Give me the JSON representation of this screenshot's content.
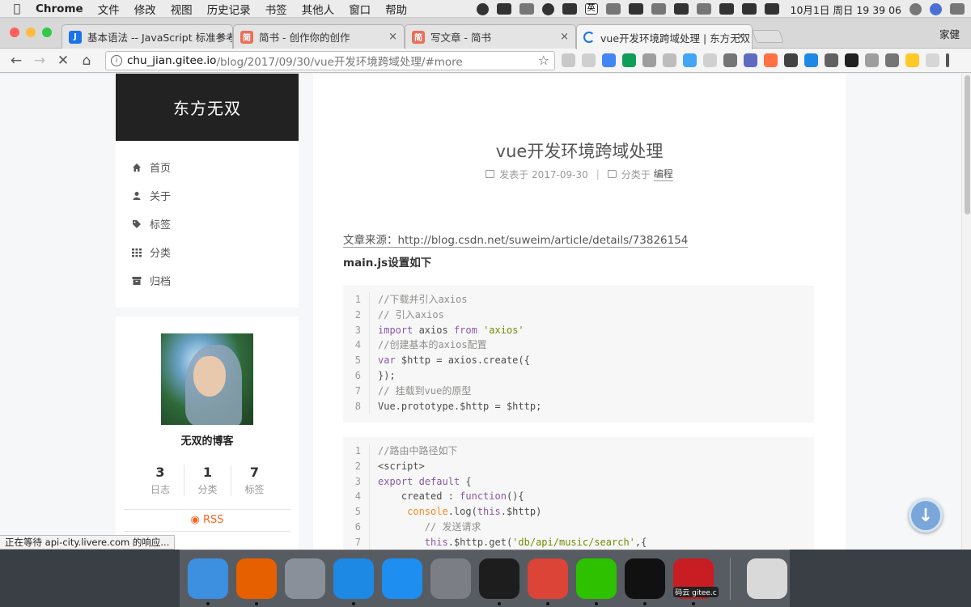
{
  "menubar": {
    "app_name": "Chrome",
    "items": [
      "文件",
      "修改",
      "视图",
      "历史记录",
      "书签",
      "其他人",
      "窗口",
      "帮助"
    ],
    "input_method": "英",
    "clock": "10月1日 周日  19 39 06"
  },
  "tabs": [
    {
      "label": "基本语法 -- JavaScript 标准参考",
      "favicon_letter": "J",
      "favicon_color": "#1a73e8"
    },
    {
      "label": "简书 - 创作你的创作",
      "favicon_letter": "简",
      "favicon_color": "#ea6f5a"
    },
    {
      "label": "写文章 - 简书",
      "favicon_letter": "简",
      "favicon_color": "#ea6f5a"
    },
    {
      "label": "vue开发环境跨域处理 | 东方无双",
      "loading": true
    }
  ],
  "profile_name": "家健",
  "address": {
    "host": "chu_jian.gitee.io",
    "path": "/blog/2017/09/30/vue开发环境跨域处理/#more"
  },
  "sidebar": {
    "brand": "东方无双",
    "menu": [
      {
        "label": "首页",
        "icon": "home-icon"
      },
      {
        "label": "关于",
        "icon": "user-icon"
      },
      {
        "label": "标签",
        "icon": "tags-icon"
      },
      {
        "label": "分类",
        "icon": "th-icon"
      },
      {
        "label": "归档",
        "icon": "archive-icon"
      }
    ],
    "author": "无双的博客",
    "stats": [
      {
        "num": "3",
        "label": "日志"
      },
      {
        "num": "1",
        "label": "分类"
      },
      {
        "num": "7",
        "label": "标签"
      }
    ],
    "rss": "RSS"
  },
  "post": {
    "title": "vue开发环境跨域处理",
    "meta_posted": "发表于 2017-09-30",
    "meta_category_prefix": "分类于",
    "meta_category": "编程",
    "source_label": "文章来源：http://blog.csdn.net/suweim/article/details/73826154",
    "subhead": "main.js设置如下"
  },
  "code_block_1": [
    [
      [
        "c-com",
        "//下载并引入axios"
      ]
    ],
    [
      [
        "c-com",
        "// 引入axios"
      ]
    ],
    [
      [
        "c-kw",
        "import"
      ],
      [
        "",
        " axios "
      ],
      [
        "c-kw",
        "from"
      ],
      [
        "",
        " "
      ],
      [
        "c-str",
        "'axios'"
      ]
    ],
    [
      [
        "c-com",
        "//创建基本的axios配置"
      ]
    ],
    [
      [
        "c-kw",
        "var"
      ],
      [
        "",
        " $http = axios.create({"
      ]
    ],
    [
      [
        "",
        "});"
      ]
    ],
    [
      [
        "c-com",
        "// 挂载到vue的原型"
      ]
    ],
    [
      [
        "",
        "Vue.prototype.$http = $http;"
      ]
    ]
  ],
  "code_block_2": [
    [
      [
        "c-com",
        "//路由中路径如下"
      ]
    ],
    [
      [
        "",
        "<script>"
      ]
    ],
    [
      [
        "c-kw",
        "export"
      ],
      [
        "",
        " "
      ],
      [
        "c-kw",
        "default"
      ],
      [
        "",
        " {"
      ]
    ],
    [
      [
        "",
        "    created : "
      ],
      [
        "c-kw",
        "function"
      ],
      [
        "",
        "(){"
      ]
    ],
    [
      [
        "",
        "     "
      ],
      [
        "c-obj",
        "console"
      ],
      [
        "",
        ".log("
      ],
      [
        "c-kw",
        "this"
      ],
      [
        "",
        ".$http)"
      ]
    ],
    [
      [
        "",
        "        "
      ],
      [
        "c-com",
        "// 发送请求"
      ]
    ],
    [
      [
        "",
        "        "
      ],
      [
        "c-kw",
        "this"
      ],
      [
        "",
        ".$http.get("
      ],
      [
        "c-str",
        "'db/api/music/search'"
      ],
      [
        "",
        ",{"
      ]
    ]
  ],
  "status_text": "正在等待 api-city.livere.com 的响应...",
  "dock": [
    {
      "name": "finder",
      "color": "#3d8fe0"
    },
    {
      "name": "firefox",
      "color": "#e66000"
    },
    {
      "name": "launchpad",
      "color": "#8a9099"
    },
    {
      "name": "safari",
      "color": "#1e88e5"
    },
    {
      "name": "app-store",
      "color": "#1e8ef0"
    },
    {
      "name": "system-preferences",
      "color": "#7b7f85"
    },
    {
      "name": "terminal",
      "color": "#1d1d1d"
    },
    {
      "name": "chrome",
      "color": "#db4437"
    },
    {
      "name": "wechat",
      "color": "#2dc100"
    },
    {
      "name": "qq",
      "color": "#111111"
    },
    {
      "name": "gitee",
      "color": "#c71d23",
      "label": "码云 gitee.c"
    }
  ],
  "colors": {
    "accent_rss": "#fc6423",
    "brand_bg": "#222222"
  }
}
